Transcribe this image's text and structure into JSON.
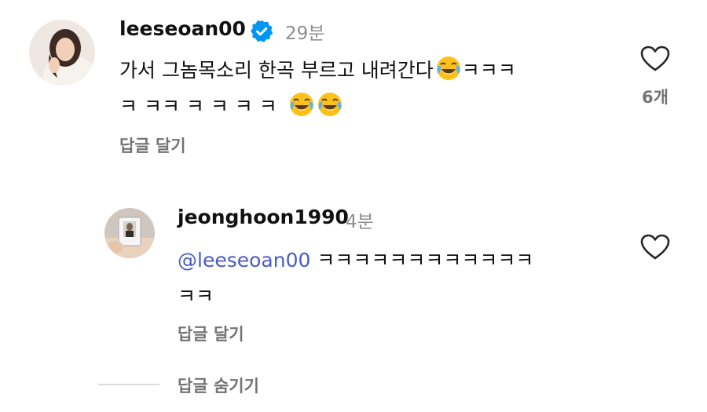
{
  "comment": {
    "username": "leeseoan00",
    "timestamp": "29분",
    "text_line1": "가서 그놈목소리 한곡 부르고 내려간다",
    "text_line1_suffix": "ㅋㅋㅋ",
    "text_line2": "ㅋ ㅋㅋ ㅋ ㅋ ㅋ ㅋ",
    "reply_label": "답글 달기",
    "like_count": "6개",
    "heart_icon": "heart-outline-icon",
    "verified_icon": "verified-badge-icon",
    "verified_color": "#0095f6"
  },
  "reply": {
    "username": "jeonghoon1990",
    "timestamp": "4분",
    "mention": "@leeseoan00",
    "text_line1": "ㅋㅋㅋㅋㅋㅋㅋㅋㅋㅋㅋㅋ",
    "text_line2": "ㅋㅋ",
    "reply_label": "답글 달기",
    "heart_icon": "heart-outline-icon"
  },
  "footer": {
    "hide_replies_label": "답글 숨기기"
  },
  "colors": {
    "text": "#111111",
    "secondary": "#737373",
    "timestamp": "#8e8e8e",
    "mention": "#4b5cc4",
    "divider": "#dbdbdb"
  }
}
